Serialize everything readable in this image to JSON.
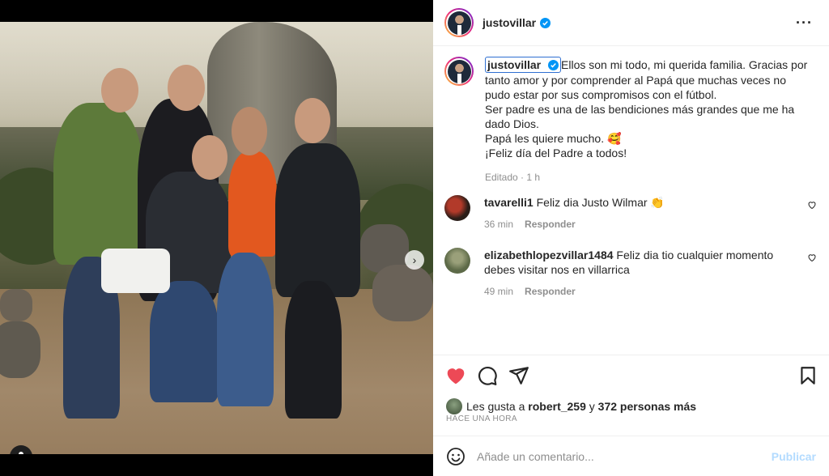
{
  "post": {
    "author": "justovillar",
    "more_icon": "more-horizontal-icon",
    "caption": {
      "username": "justovillar",
      "lines": [
        "Ellos son mi todo, mi querida familia. Gracias por",
        "tanto amor y por comprender al Papá que muchas veces no",
        "pudo estar por sus compromisos con el fútbol.",
        "Ser padre es una de las bendiciones más grandes que me ha",
        "dado Dios.",
        "Papá les quiere mucho. 🥰",
        "¡Feliz día del Padre a todos!"
      ],
      "meta": "Editado · 1 h"
    },
    "comments": [
      {
        "username": "tavarelli1",
        "text": "Feliz dia Justo Wilmar 👏",
        "time": "36 min",
        "reply_label": "Responder"
      },
      {
        "username": "elizabethlopezvillar1484",
        "text": "Feliz dia tio cualquier momento debes visitar nos en villarrica",
        "time": "49 min",
        "reply_label": "Responder"
      }
    ],
    "likes": {
      "prefix": "Les gusta a",
      "user": "robert_259",
      "connector": "y",
      "others": "372 personas más"
    },
    "time_ago": "HACE UNA HORA",
    "composer": {
      "placeholder": "Añade un comentario...",
      "publish_label": "Publicar"
    },
    "carousel": {
      "current": 1,
      "total": 2
    },
    "colors": {
      "like_red": "#ed4956",
      "verified_blue": "#0095f6",
      "publish_disabled": "#b3dbff"
    }
  }
}
